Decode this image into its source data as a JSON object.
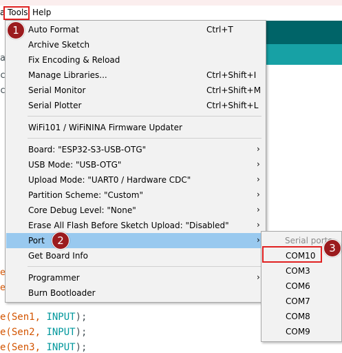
{
  "menubar": {
    "left_fragment": "a",
    "tools": "Tools",
    "help": "Help"
  },
  "editor": {
    "edge_chars": [
      "a",
      "c",
      "c",
      "e",
      "e"
    ],
    "code_lines": [
      {
        "prefix": "e(Sen1, ",
        "kw": "INPUT",
        "suffix": ");"
      },
      {
        "prefix": "e(Sen2, ",
        "kw": "INPUT",
        "suffix": ");"
      },
      {
        "prefix": "e(Sen3, ",
        "kw": "INPUT",
        "suffix": ");"
      }
    ]
  },
  "tools_menu": {
    "items": [
      {
        "label": "Auto Format",
        "shortcut": "Ctrl+T"
      },
      {
        "label": "Archive Sketch",
        "shortcut": ""
      },
      {
        "label": "Fix Encoding & Reload",
        "shortcut": ""
      },
      {
        "label": "Manage Libraries...",
        "shortcut": "Ctrl+Shift+I"
      },
      {
        "label": "Serial Monitor",
        "shortcut": "Ctrl+Shift+M"
      },
      {
        "label": "Serial Plotter",
        "shortcut": "Ctrl+Shift+L"
      },
      {
        "label": "WiFi101 / WiFiNINA Firmware Updater",
        "shortcut": ""
      },
      {
        "label": "Board: \"ESP32-S3-USB-OTG\"",
        "submenu": true
      },
      {
        "label": "USB Mode: \"USB-OTG\"",
        "submenu": true
      },
      {
        "label": "Upload Mode: \"UART0 / Hardware CDC\"",
        "submenu": true
      },
      {
        "label": "Partition Scheme: \"Custom\"",
        "submenu": true
      },
      {
        "label": "Core Debug Level: \"None\"",
        "submenu": true
      },
      {
        "label": "Erase All Flash Before Sketch Upload: \"Disabled\"",
        "submenu": true
      },
      {
        "label": "Port",
        "submenu": true,
        "highlighted": true
      },
      {
        "label": "Get Board Info",
        "shortcut": ""
      },
      {
        "label": "Programmer",
        "submenu": true
      },
      {
        "label": "Burn Bootloader",
        "shortcut": ""
      }
    ],
    "submenu_arrow": "›"
  },
  "port_submenu": {
    "header": "Serial ports",
    "ports": [
      "COM10",
      "COM3",
      "COM6",
      "COM7",
      "COM8",
      "COM9"
    ],
    "selected": "COM10"
  },
  "steps": [
    "1",
    "2",
    "3"
  ],
  "colors": {
    "highlight": "#99c9ef",
    "annotation_red": "#e02020",
    "badge": "#9b1b1e",
    "teal_dark": "#006468",
    "teal_light": "#17a1a5"
  }
}
